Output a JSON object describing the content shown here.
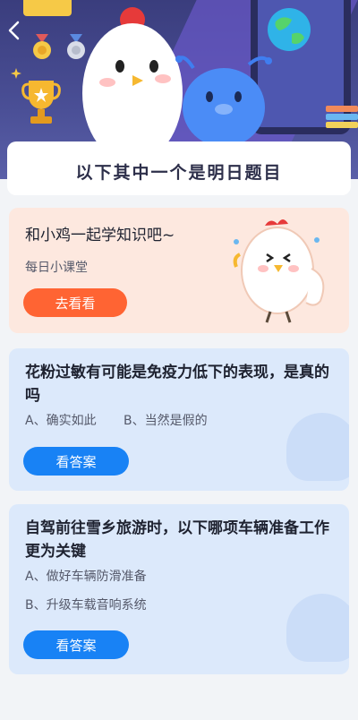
{
  "nav": {
    "back_icon": "chevron-left-icon"
  },
  "banner": {
    "title": "以下其中一个是明日题目"
  },
  "promo": {
    "title": "和小鸡一起学知识吧~",
    "subtitle": "每日小课堂",
    "button_label": "去看看"
  },
  "questions": [
    {
      "title": "花粉过敏有可能是免疫力低下的表现，是真的吗",
      "option_a": "A、确实如此",
      "option_b": "B、当然是假的",
      "button_label": "看答案"
    },
    {
      "title": "自驾前往雪乡旅游时，以下哪项车辆准备工作更为关键",
      "option_a": "A、做好车辆防滑准备",
      "option_b": "B、升级车载音响系统",
      "button_label": "看答案"
    }
  ],
  "colors": {
    "hero_bg": "#3a3d7d",
    "promo_bg": "#fde8df",
    "question_bg": "#dce9fb",
    "orange_button": "#ff6433",
    "blue_button": "#1882f5"
  }
}
